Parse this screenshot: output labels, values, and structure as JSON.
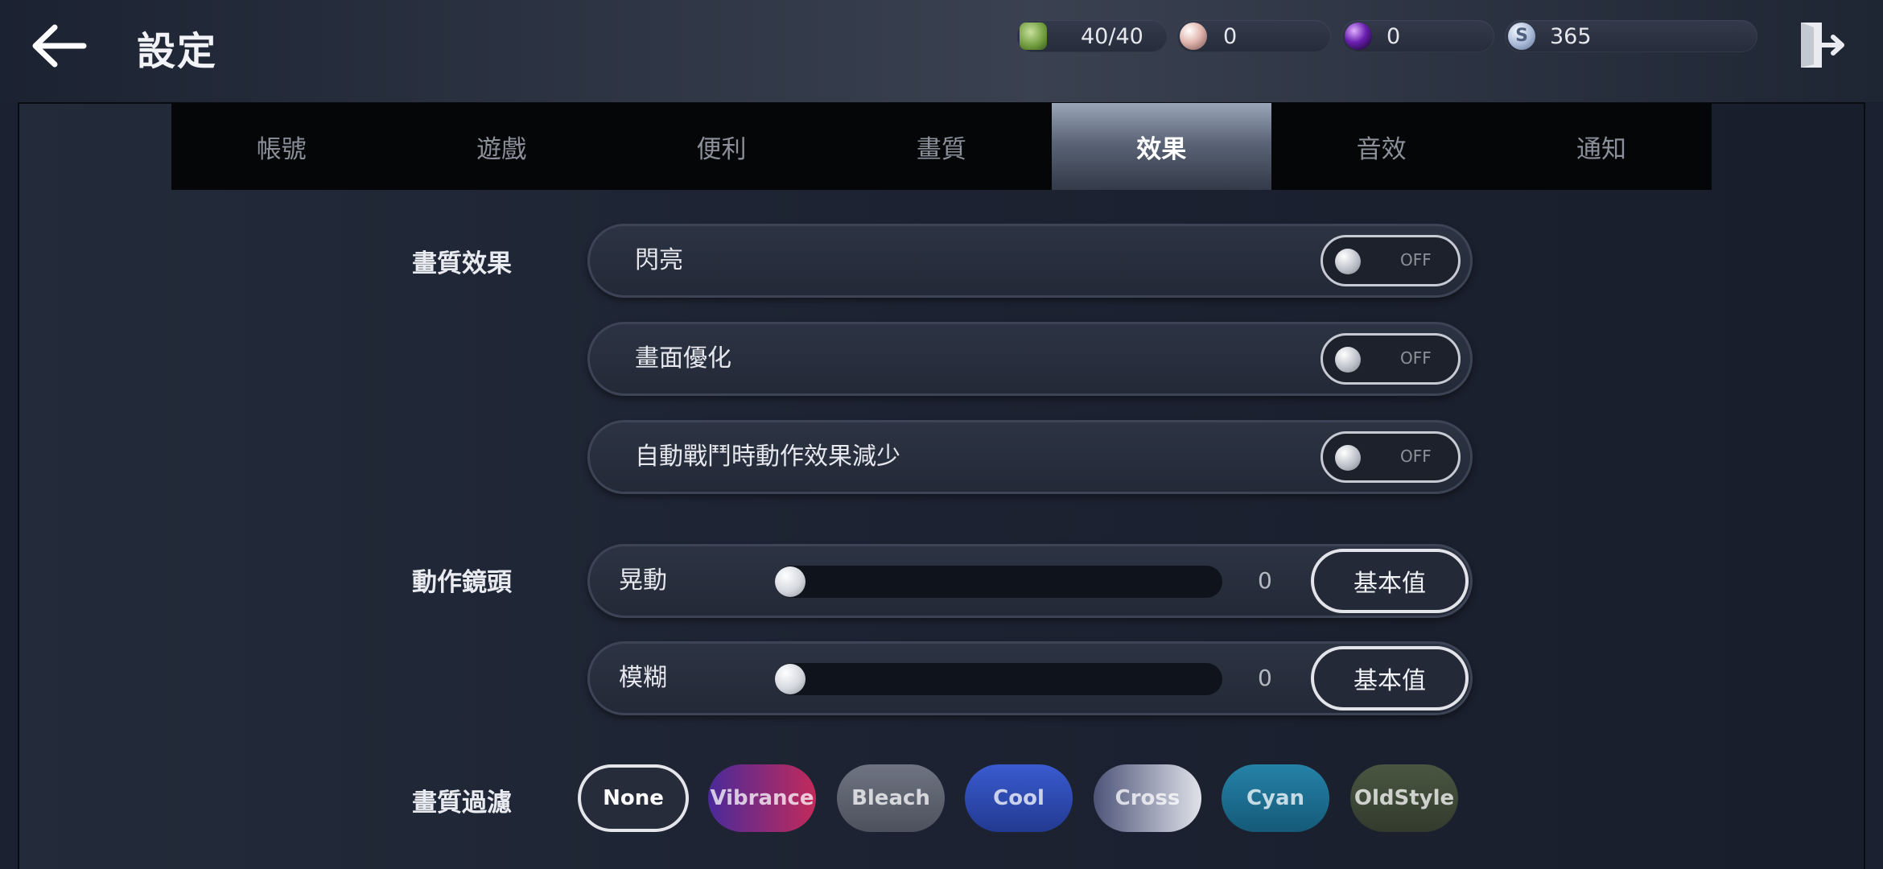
{
  "header": {
    "title": "設定",
    "currencies": {
      "stamina": "40/40",
      "pearl": "0",
      "orb": "0",
      "coin": "365",
      "coin_icon_glyph": "S"
    }
  },
  "tabs": [
    {
      "label": "帳號"
    },
    {
      "label": "遊戲"
    },
    {
      "label": "便利"
    },
    {
      "label": "畫質"
    },
    {
      "label": "效果",
      "active": true
    },
    {
      "label": "音效"
    },
    {
      "label": "通知"
    }
  ],
  "sections": {
    "visual_effects": {
      "label": "畫質效果",
      "toggles": [
        {
          "label": "閃亮",
          "state": "OFF"
        },
        {
          "label": "畫面優化",
          "state": "OFF"
        },
        {
          "label": "自動戰鬥時動作效果減少",
          "state": "OFF"
        }
      ]
    },
    "camera": {
      "label": "動作鏡頭",
      "sliders": [
        {
          "label": "晃動",
          "value": "0",
          "reset_label": "基本值"
        },
        {
          "label": "模糊",
          "value": "0",
          "reset_label": "基本值"
        }
      ]
    },
    "filter": {
      "label": "畫質過濾",
      "selected": "None",
      "options": [
        {
          "label": "None",
          "color": "#262c3a"
        },
        {
          "label": "Vibrance",
          "color": "#8e2a6a"
        },
        {
          "label": "Bleach",
          "color": "#5d6270"
        },
        {
          "label": "Cool",
          "color": "#2c49a8"
        },
        {
          "label": "Cross",
          "color": "#8a8ea6"
        },
        {
          "label": "Cyan",
          "color": "#1e6a8f"
        },
        {
          "label": "OldStyle",
          "color": "#3f4a38"
        }
      ]
    }
  },
  "colors": {
    "accent_tab": "#5b6577",
    "panel": "#1c2231",
    "text": "#e8eaf0"
  }
}
